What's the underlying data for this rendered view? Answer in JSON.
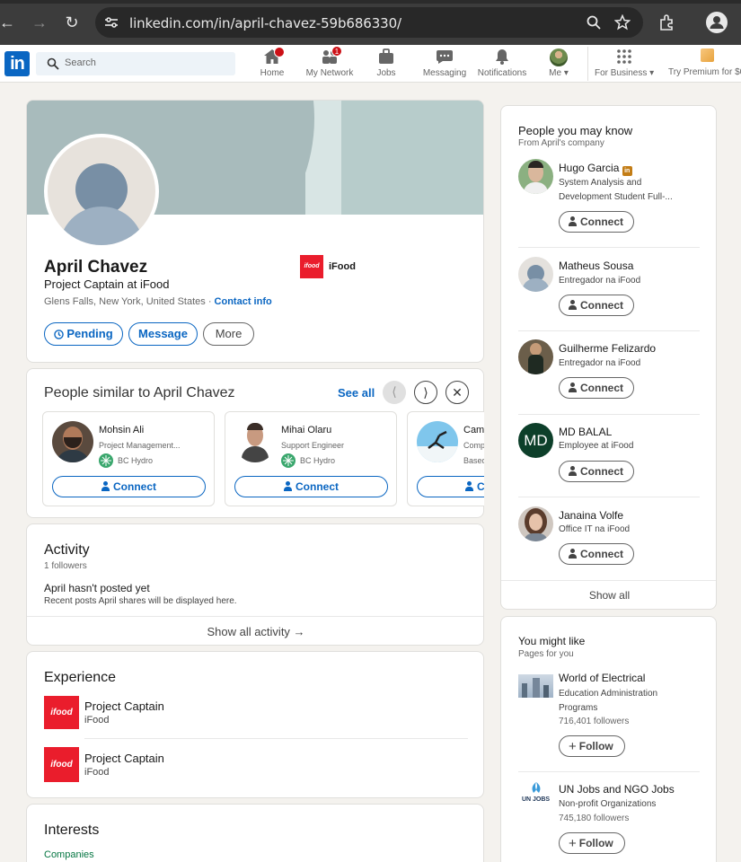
{
  "browser": {
    "url": "linkedin.com/in/april-chavez-59b686330/"
  },
  "header": {
    "logo": "in",
    "search_placeholder": "Search",
    "nav": [
      {
        "label": "Home",
        "icon": "home-icon",
        "badge": ""
      },
      {
        "label": "My Network",
        "icon": "network-icon",
        "badge": "1"
      },
      {
        "label": "Jobs",
        "icon": "briefcase-icon",
        "badge": ""
      },
      {
        "label": "Messaging",
        "icon": "message-icon",
        "badge": ""
      },
      {
        "label": "Notifications",
        "icon": "bell-icon",
        "badge": ""
      },
      {
        "label": "Me",
        "icon": "avatar-icon",
        "badge": ""
      }
    ],
    "for_business": "For Business",
    "premium": "Try Premium for $0"
  },
  "profile": {
    "name": "April Chavez",
    "headline": "Project Captain at iFood",
    "location": "Glens Falls, New York, United States",
    "dot": "·",
    "contact_info": "Contact info",
    "company": "iFood",
    "company_logo_text": "ifood",
    "pending": "Pending",
    "message": "Message",
    "more": "More"
  },
  "similar": {
    "title": "People similar to April Chavez",
    "see_all": "See all",
    "people": [
      {
        "name": "Mohsin Ali",
        "headline": "Project Management...",
        "company": "BC Hydro",
        "connect": "Connect"
      },
      {
        "name": "Mihai Olaru",
        "headline": "Support Engineer",
        "company": "BC Hydro",
        "connect": "Connect"
      },
      {
        "name": "Cam",
        "headline": "Comp",
        "company": "Based",
        "connect": "C"
      }
    ]
  },
  "activity": {
    "title": "Activity",
    "followers": "1 followers",
    "empty_title": "April hasn't posted yet",
    "empty_sub": "Recent posts April shares will be displayed here.",
    "show_all": "Show all activity →"
  },
  "experience": {
    "title": "Experience",
    "items": [
      {
        "role": "Project Captain",
        "company": "iFood"
      },
      {
        "role": "Project Captain",
        "company": "iFood"
      }
    ]
  },
  "interests": {
    "title": "Interests",
    "tab": "Companies"
  },
  "pymk": {
    "title": "People you may know",
    "subtitle": "From April's company",
    "people": [
      {
        "name": "Hugo Garcia",
        "headline1": "System Analysis and",
        "headline2": "Development Student Full-...",
        "connect": "Connect"
      },
      {
        "name": "Matheus Sousa",
        "headline1": "Entregador na iFood",
        "headline2": "",
        "connect": "Connect"
      },
      {
        "name": "Guilherme Felizardo",
        "headline1": "Entregador na iFood",
        "headline2": "",
        "connect": "Connect"
      },
      {
        "name": "MD BALAL",
        "headline1": "Employee at iFood",
        "headline2": "",
        "connect": "Connect",
        "initials": "MD"
      },
      {
        "name": "Janaina Volfe",
        "headline1": "Office IT na iFood",
        "headline2": "",
        "connect": "Connect"
      }
    ],
    "show_all": "Show all"
  },
  "might_like": {
    "title": "You might like",
    "subtitle": "Pages for you",
    "pages": [
      {
        "name": "World of Electrical",
        "category1": "Education Administration",
        "category2": "Programs",
        "followers": "716,401 followers",
        "follow": "Follow"
      },
      {
        "name": "UN Jobs and NGO Jobs",
        "category1": "Non-profit Organizations",
        "category2": "",
        "followers": "745,180 followers",
        "follow": "Follow",
        "logo_text": "UN JOBS"
      }
    ]
  },
  "colors": {
    "linkedin_blue": "#0a66c2",
    "ifood_red": "#ea1d2c",
    "page_bg": "#f4f2ee",
    "badge_red": "#cc1016"
  }
}
